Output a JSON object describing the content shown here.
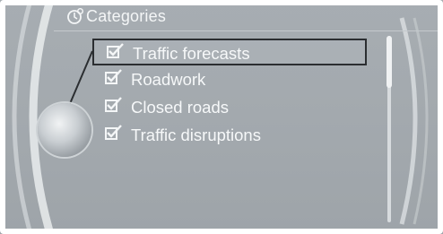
{
  "header": {
    "title": "Categories",
    "icon": "navigation-settings-icon"
  },
  "menu": {
    "items": [
      {
        "label": "Traffic forecasts",
        "checked": true,
        "selected": true
      },
      {
        "label": "Roadwork",
        "checked": true,
        "selected": false
      },
      {
        "label": "Closed roads",
        "checked": true,
        "selected": false
      },
      {
        "label": "Traffic disruptions",
        "checked": true,
        "selected": false
      }
    ]
  },
  "colors": {
    "background": "#a3a9ae",
    "text": "#f6f8f9",
    "selection_border": "#2b2e31"
  },
  "controller": {
    "icon": "idrive-controller-icon"
  },
  "scroll": {
    "position": 0
  }
}
